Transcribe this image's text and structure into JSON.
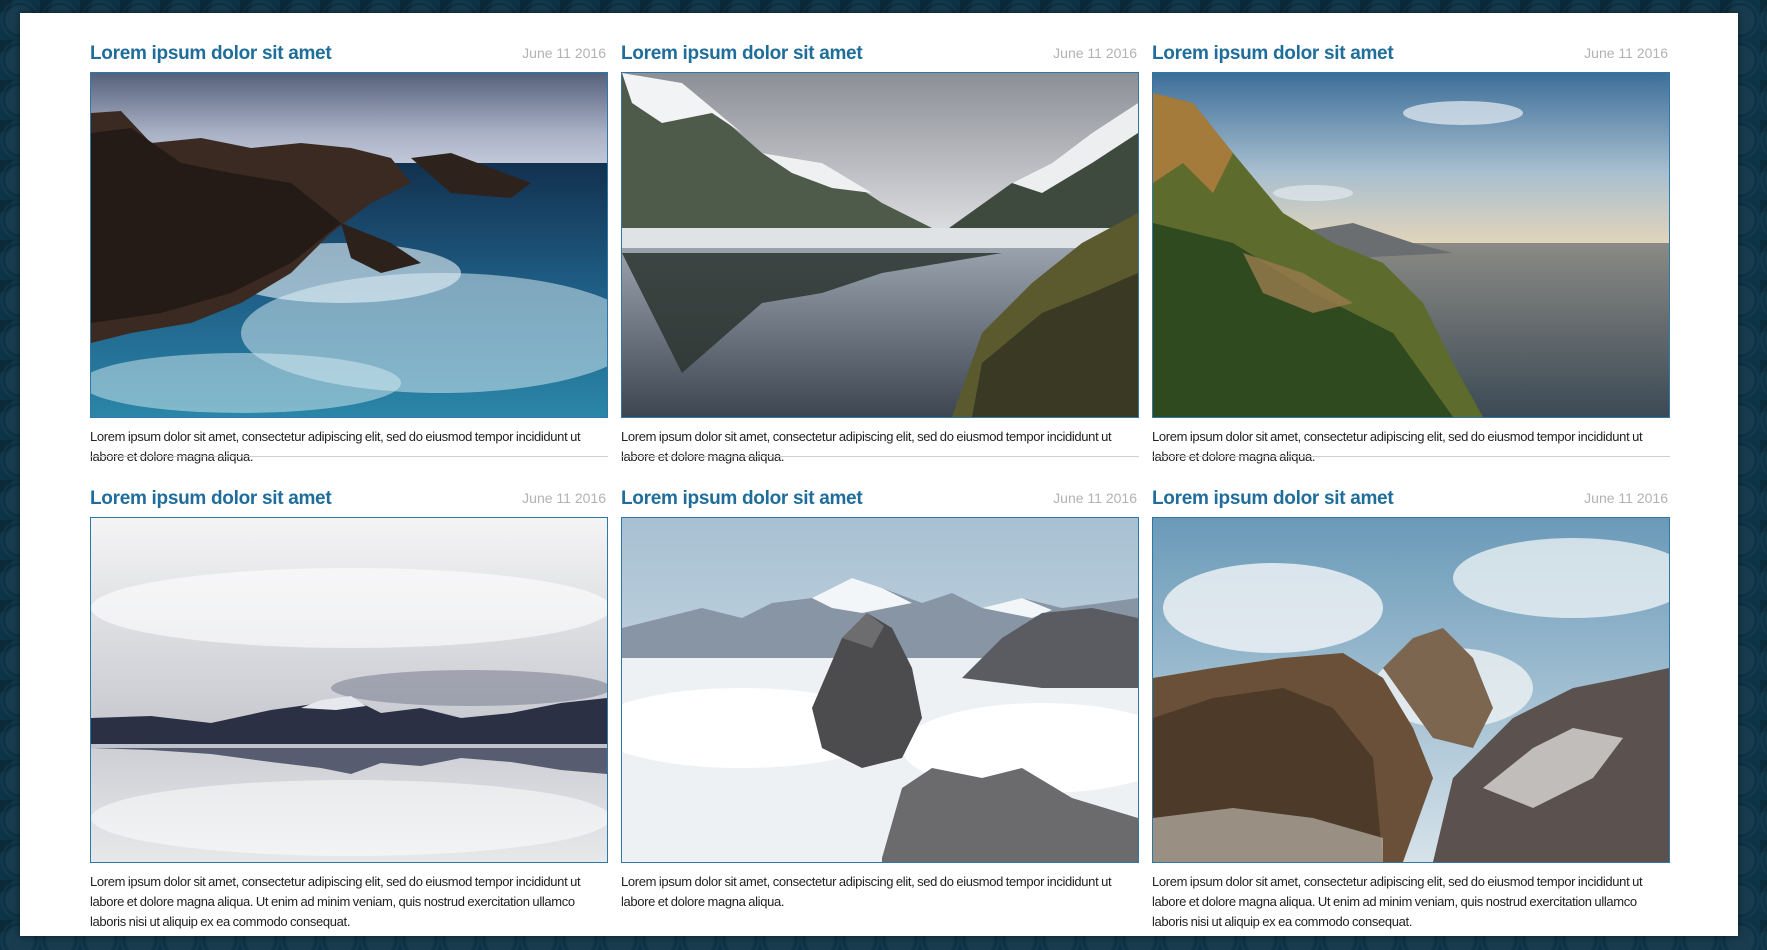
{
  "posts": [
    {
      "title": "Lorem ipsum dolor sit amet",
      "date": "June 11 2016",
      "image": "rocky-coast-waves",
      "excerpt": "Lorem ipsum dolor sit amet, consectetur adipiscing elit, sed do eiusmod tempor incididunt ut labore et dolore magna aliqua."
    },
    {
      "title": "Lorem ipsum dolor sit amet",
      "date": "June 11 2016",
      "image": "mountain-lake-reflection",
      "excerpt": "Lorem ipsum dolor sit amet, consectetur adipiscing elit, sed do eiusmod tempor incididunt ut labore et dolore magna aliqua."
    },
    {
      "title": "Lorem ipsum dolor sit amet",
      "date": "June 11 2016",
      "image": "coastal-cliff-sunset",
      "excerpt": "Lorem ipsum dolor sit amet, consectetur adipiscing elit, sed do eiusmod tempor incididunt ut labore et dolore magna aliqua."
    },
    {
      "title": "Lorem ipsum dolor sit amet",
      "date": "June 11 2016",
      "image": "cloudy-mountain-reflection",
      "excerpt": "Lorem ipsum dolor sit amet, consectetur adipiscing elit, sed do eiusmod tempor incididunt ut labore et dolore magna aliqua. Ut enim ad minim veniam, quis nostrud exercitation ullamco laboris nisi ut aliquip ex ea commodo consequat."
    },
    {
      "title": "Lorem ipsum dolor sit amet",
      "date": "June 11 2016",
      "image": "peaks-above-clouds",
      "excerpt": "Lorem ipsum dolor sit amet, consectetur adipiscing elit, sed do eiusmod tempor incididunt ut labore et dolore magna aliqua."
    },
    {
      "title": "Lorem ipsum dolor sit amet",
      "date": "June 11 2016",
      "image": "misty-rocky-mountains",
      "excerpt": "Lorem ipsum dolor sit amet, consectetur adipiscing elit, sed do eiusmod tempor incididunt ut labore et dolore magna aliqua. Ut enim ad minim veniam, quis nostrud exercitation ullamco laboris nisi ut aliquip ex ea commodo consequat."
    }
  ],
  "colors": {
    "title": "#1f6d9a",
    "date": "#b2b2b2",
    "image_border": "#2f78a6",
    "background": "#0d3346"
  }
}
